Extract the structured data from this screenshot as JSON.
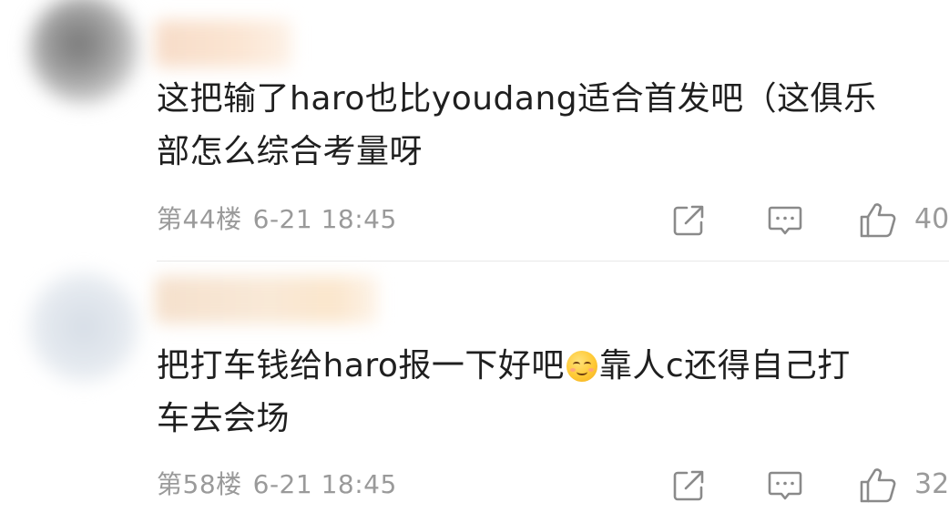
{
  "comments": [
    {
      "text_lines": [
        "这把输了haro也比youdang适合首发吧（这俱乐",
        "部怎么综合考量呀"
      ],
      "floor": "第44楼",
      "time": "6-21 18:45",
      "likes": "40"
    },
    {
      "text_before_emoji": "把打车钱给haro报一下好吧",
      "emoji": "smiling-blush-emoji",
      "text_after_emoji": "靠人c还得自己打",
      "text_line2": "车去会场",
      "floor": "第58楼",
      "time": "6-21 18:45",
      "likes": "32"
    }
  ],
  "icons": {
    "share": "share-edit-icon",
    "reply": "comment-reply-icon",
    "like": "thumbs-up-icon"
  },
  "colors": {
    "text": "#1f1f1f",
    "meta": "#9a9a9a",
    "icon": "#8a8a8a",
    "divider": "#e8e8e8"
  }
}
